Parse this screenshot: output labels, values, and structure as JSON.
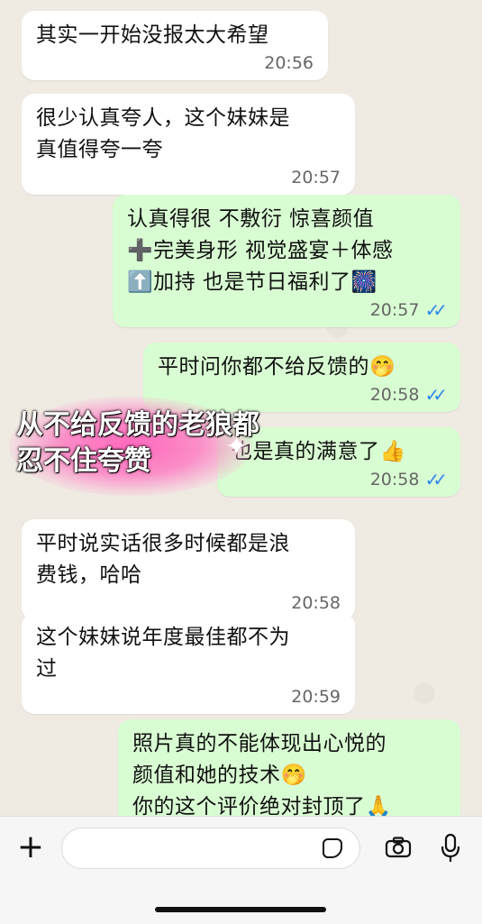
{
  "messages": [
    {
      "dir": "in",
      "text": "其实一开始没报太大希望",
      "time": "20:56"
    },
    {
      "dir": "in",
      "text": "很少认真夸人，这个妹妹是\n真值得夸一夸",
      "time": "20:57"
    },
    {
      "dir": "out",
      "text": "认真得很 不敷衍 惊喜颜值\n➕完美身形 视觉盛宴＋体感\n⬆️加持 也是节日福利了🎆",
      "time": "20:57"
    },
    {
      "dir": "out",
      "text": "平时问你都不给反馈的🤭",
      "time": "20:58"
    },
    {
      "dir": "out",
      "text": "也是真的满意了👍",
      "time": "20:58"
    },
    {
      "dir": "in",
      "text": "平时说实话很多时候都是浪\n费钱，哈哈",
      "time": "20:58"
    },
    {
      "dir": "in",
      "text": "这个妹妹说年度最佳都不为\n过",
      "time": "20:59"
    },
    {
      "dir": "out",
      "text": "照片真的不能体现出心悦的\n颜值和她的技术🤭\n你的这个评价绝对封顶了🙏",
      "time": ""
    }
  ],
  "overlay": {
    "text": "从不给反馈的老狼都忍不住夸赞"
  },
  "composer": {
    "placeholder": ""
  },
  "colors": {
    "incoming_bubble": "#ffffff",
    "outgoing_bubble": "#d9fdd3",
    "read_ticks": "#2f87ea",
    "chat_background": "#efeae2"
  }
}
